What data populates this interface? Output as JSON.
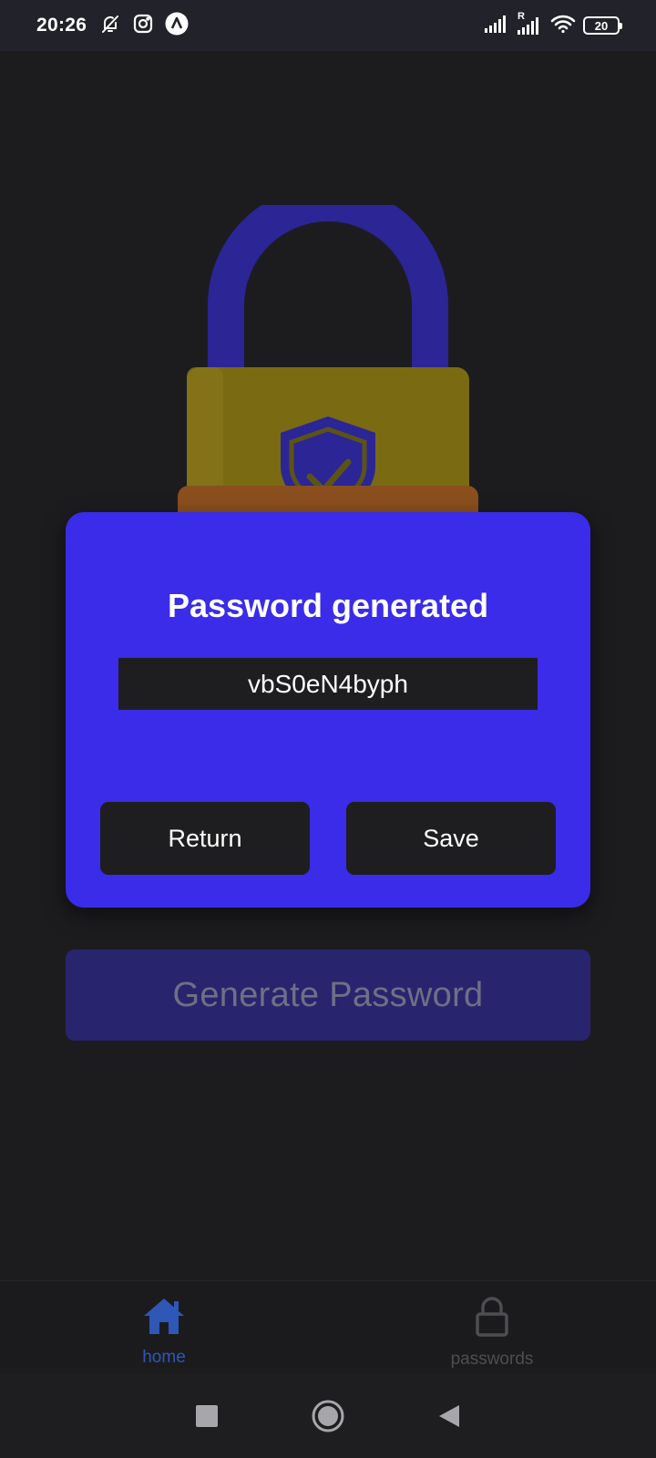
{
  "status_bar": {
    "time": "20:26",
    "left_icons": [
      "bell-off-icon",
      "instagram-icon",
      "app-a-icon"
    ],
    "right_icons": [
      "signal-icon",
      "signal-roaming-icon",
      "wifi-icon",
      "battery-icon"
    ],
    "roaming_label": "R",
    "battery_level": "20"
  },
  "illustration": {
    "icon": "padlock-shield-icon",
    "colors": {
      "shackle": "#2b2596",
      "body": "#7a6a12",
      "shield": "#2b2596"
    }
  },
  "dialog": {
    "title": "Password generated",
    "password": "vbS0eN4byph",
    "return_label": "Return",
    "save_label": "Save",
    "background": "#3a2ce8"
  },
  "main": {
    "generate_label": "Generate Password"
  },
  "bottom_nav": {
    "items": [
      {
        "label": "home",
        "icon": "home-icon",
        "active": true
      },
      {
        "label": "passwords",
        "icon": "lock-icon",
        "active": false
      }
    ],
    "active_color": "#2f57b6"
  },
  "system_nav": {
    "icons": [
      "recents-icon",
      "home-circle-icon",
      "back-icon"
    ]
  }
}
